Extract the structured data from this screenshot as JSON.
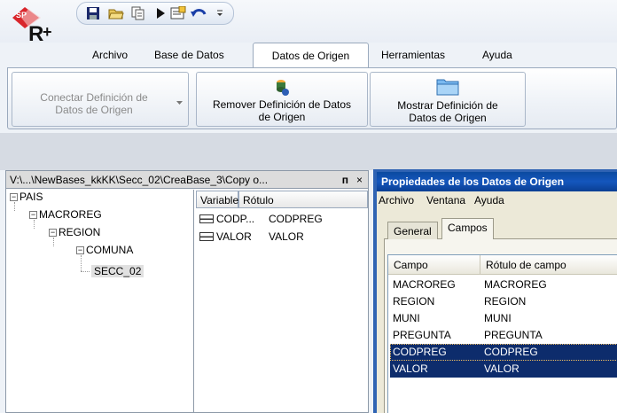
{
  "app": {
    "quick_access": [
      "save-icon",
      "open-icon",
      "copy-icon",
      "play-icon",
      "properties-icon",
      "undo-icon"
    ]
  },
  "menu": {
    "tabs": [
      {
        "label": "Archivo"
      },
      {
        "label": "Base de Datos"
      },
      {
        "label": "Datos de Origen",
        "active": true
      },
      {
        "label": "Herramientas"
      },
      {
        "label": "Ayuda"
      }
    ]
  },
  "ribbon": {
    "conectar": "Conectar Definición de\nDatos de Origen",
    "remover": "Remover Definición de Datos\nde Origen",
    "mostrar": "Mostrar Definición de\nDatos de Origen"
  },
  "left_panel": {
    "title": "V:\\...\\NewBases_kkKK\\Secc_02\\CreaBase_3\\Copy o...",
    "pin": "ᴨ",
    "close": "×",
    "tree": [
      {
        "label": "PAIS",
        "level": 0,
        "expanded": true
      },
      {
        "label": "MACROREG",
        "level": 1,
        "expanded": true
      },
      {
        "label": "REGION",
        "level": 2,
        "expanded": true
      },
      {
        "label": "COMUNA",
        "level": 3,
        "expanded": true
      },
      {
        "label": "SECC_02",
        "level": 4,
        "selected": true
      }
    ],
    "var_columns": [
      "Variable",
      "Rótulo"
    ],
    "var_rows": [
      {
        "variable": "CODP...",
        "rotulo": "CODPREG"
      },
      {
        "variable": "VALOR",
        "rotulo": "VALOR"
      }
    ]
  },
  "properties": {
    "title": "Propiedades de los Datos de Origen",
    "menu": [
      "Archivo",
      "Ventana",
      "Ayuda"
    ],
    "tabs": [
      {
        "label": "General"
      },
      {
        "label": "Campos",
        "active": true
      }
    ],
    "columns": [
      "Campo",
      "Rótulo de campo"
    ],
    "rows": [
      {
        "campo": "MACROREG",
        "rotulo": "MACROREG"
      },
      {
        "campo": "REGION",
        "rotulo": "REGION"
      },
      {
        "campo": "MUNI",
        "rotulo": "MUNI"
      },
      {
        "campo": "PREGUNTA",
        "rotulo": "PREGUNTA"
      },
      {
        "campo": "CODPREG",
        "rotulo": "CODPREG",
        "selected": true
      },
      {
        "campo": "VALOR",
        "rotulo": "VALOR",
        "selected": true
      }
    ]
  }
}
